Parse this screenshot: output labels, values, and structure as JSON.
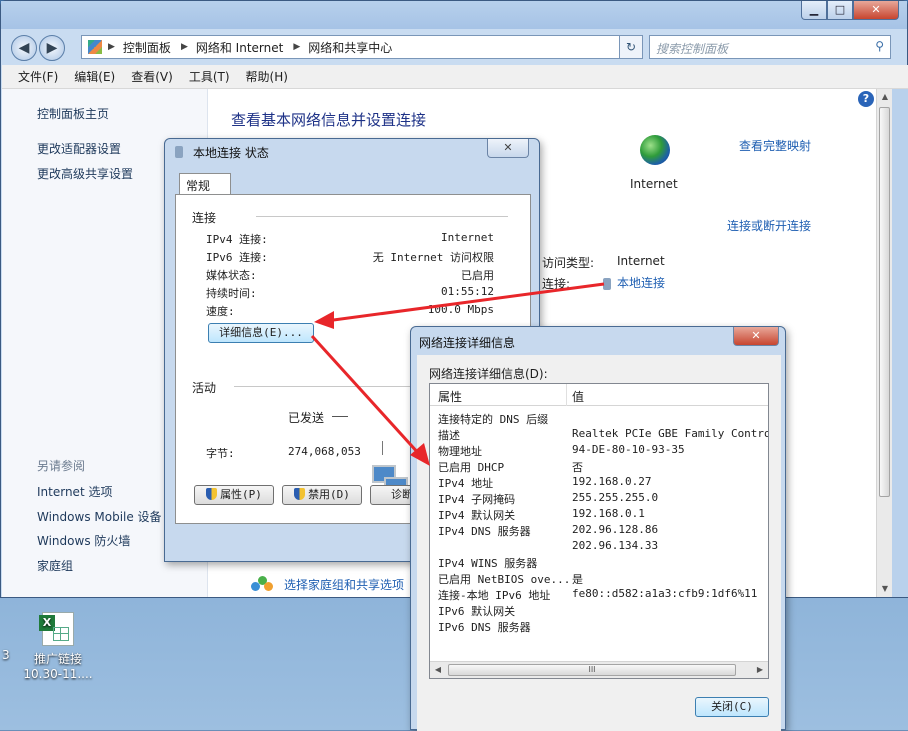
{
  "explorer": {
    "caption": {
      "min": "▁",
      "max": "□",
      "close": "✕"
    },
    "breadcrumb": [
      "控制面板",
      "网络和 Internet",
      "网络和共享中心"
    ],
    "search_placeholder": "搜索控制面板",
    "menu": [
      "文件(F)",
      "编辑(E)",
      "查看(V)",
      "工具(T)",
      "帮助(H)"
    ],
    "sidebar": {
      "top_links": [
        "控制面板主页",
        "更改适配器设置",
        "更改高级共享设置"
      ],
      "see_also_heading": "另请参阅",
      "see_also_links": [
        "Internet 选项",
        "Windows Mobile 设备",
        "Windows 防火墙",
        "家庭组"
      ]
    },
    "content": {
      "title": "查看基本网络信息并设置连接",
      "view_full_map": "查看完整映射",
      "internet_label": "Internet",
      "connect_disconnect": "连接或断开连接",
      "access_type_label": "访问类型:",
      "access_type_value": "Internet",
      "connection_label": "连接:",
      "connection_value": "本地连接",
      "homegroup_link": "选择家庭组和共享选项"
    }
  },
  "desktop": {
    "icon_label_1": "推广链接",
    "icon_label_2": "10.30-11....",
    "edge_text": "3"
  },
  "status_dialog": {
    "title": "本地连接 状态",
    "close": "✕",
    "tab": "常规",
    "connection_group": "连接",
    "rows": [
      {
        "label": "IPv4 连接:",
        "value": "Internet"
      },
      {
        "label": "IPv6 连接:",
        "value": "无 Internet 访问权限"
      },
      {
        "label": "媒体状态:",
        "value": "已启用"
      },
      {
        "label": "持续时间:",
        "value": "01:55:12"
      },
      {
        "label": "速度:",
        "value": "100.0 Mbps"
      }
    ],
    "details_button": "详细信息(E)...",
    "activity_group": "活动",
    "sent_label": "已发送",
    "bytes_label": "字节:",
    "bytes_value": "274,068,053",
    "buttons": [
      "属性(P)",
      "禁用(D)",
      "诊断"
    ]
  },
  "details_dialog": {
    "title": "网络连接详细信息",
    "close": "✕",
    "list_label": "网络连接详细信息(D):",
    "columns": [
      "属性",
      "值"
    ],
    "rows": [
      {
        "prop": "连接特定的 DNS 后缀",
        "value": ""
      },
      {
        "prop": "描述",
        "value": "Realtek PCIe GBE Family Controller"
      },
      {
        "prop": "物理地址",
        "value": "94-DE-80-10-93-35"
      },
      {
        "prop": "已启用 DHCP",
        "value": "否"
      },
      {
        "prop": "IPv4 地址",
        "value": "192.168.0.27"
      },
      {
        "prop": "IPv4 子网掩码",
        "value": "255.255.255.0"
      },
      {
        "prop": "IPv4 默认网关",
        "value": "192.168.0.1"
      },
      {
        "prop": "IPv4 DNS 服务器",
        "value": "202.96.128.86"
      },
      {
        "prop": "",
        "value": "202.96.134.33"
      },
      {
        "prop": "IPv4 WINS 服务器",
        "value": ""
      },
      {
        "prop": "已启用 NetBIOS ove...",
        "value": "是"
      },
      {
        "prop": "连接-本地 IPv6 地址",
        "value": "fe80::d582:a1a3:cfb9:1df6%11"
      },
      {
        "prop": "IPv6 默认网关",
        "value": ""
      },
      {
        "prop": "IPv6 DNS 服务器",
        "value": ""
      }
    ],
    "hscroll_grip": "III",
    "close_button": "关闭(C)"
  },
  "colors": {
    "arrow": "#e8262a",
    "link": "#1f5fb2",
    "title_blue": "#1e3287"
  }
}
